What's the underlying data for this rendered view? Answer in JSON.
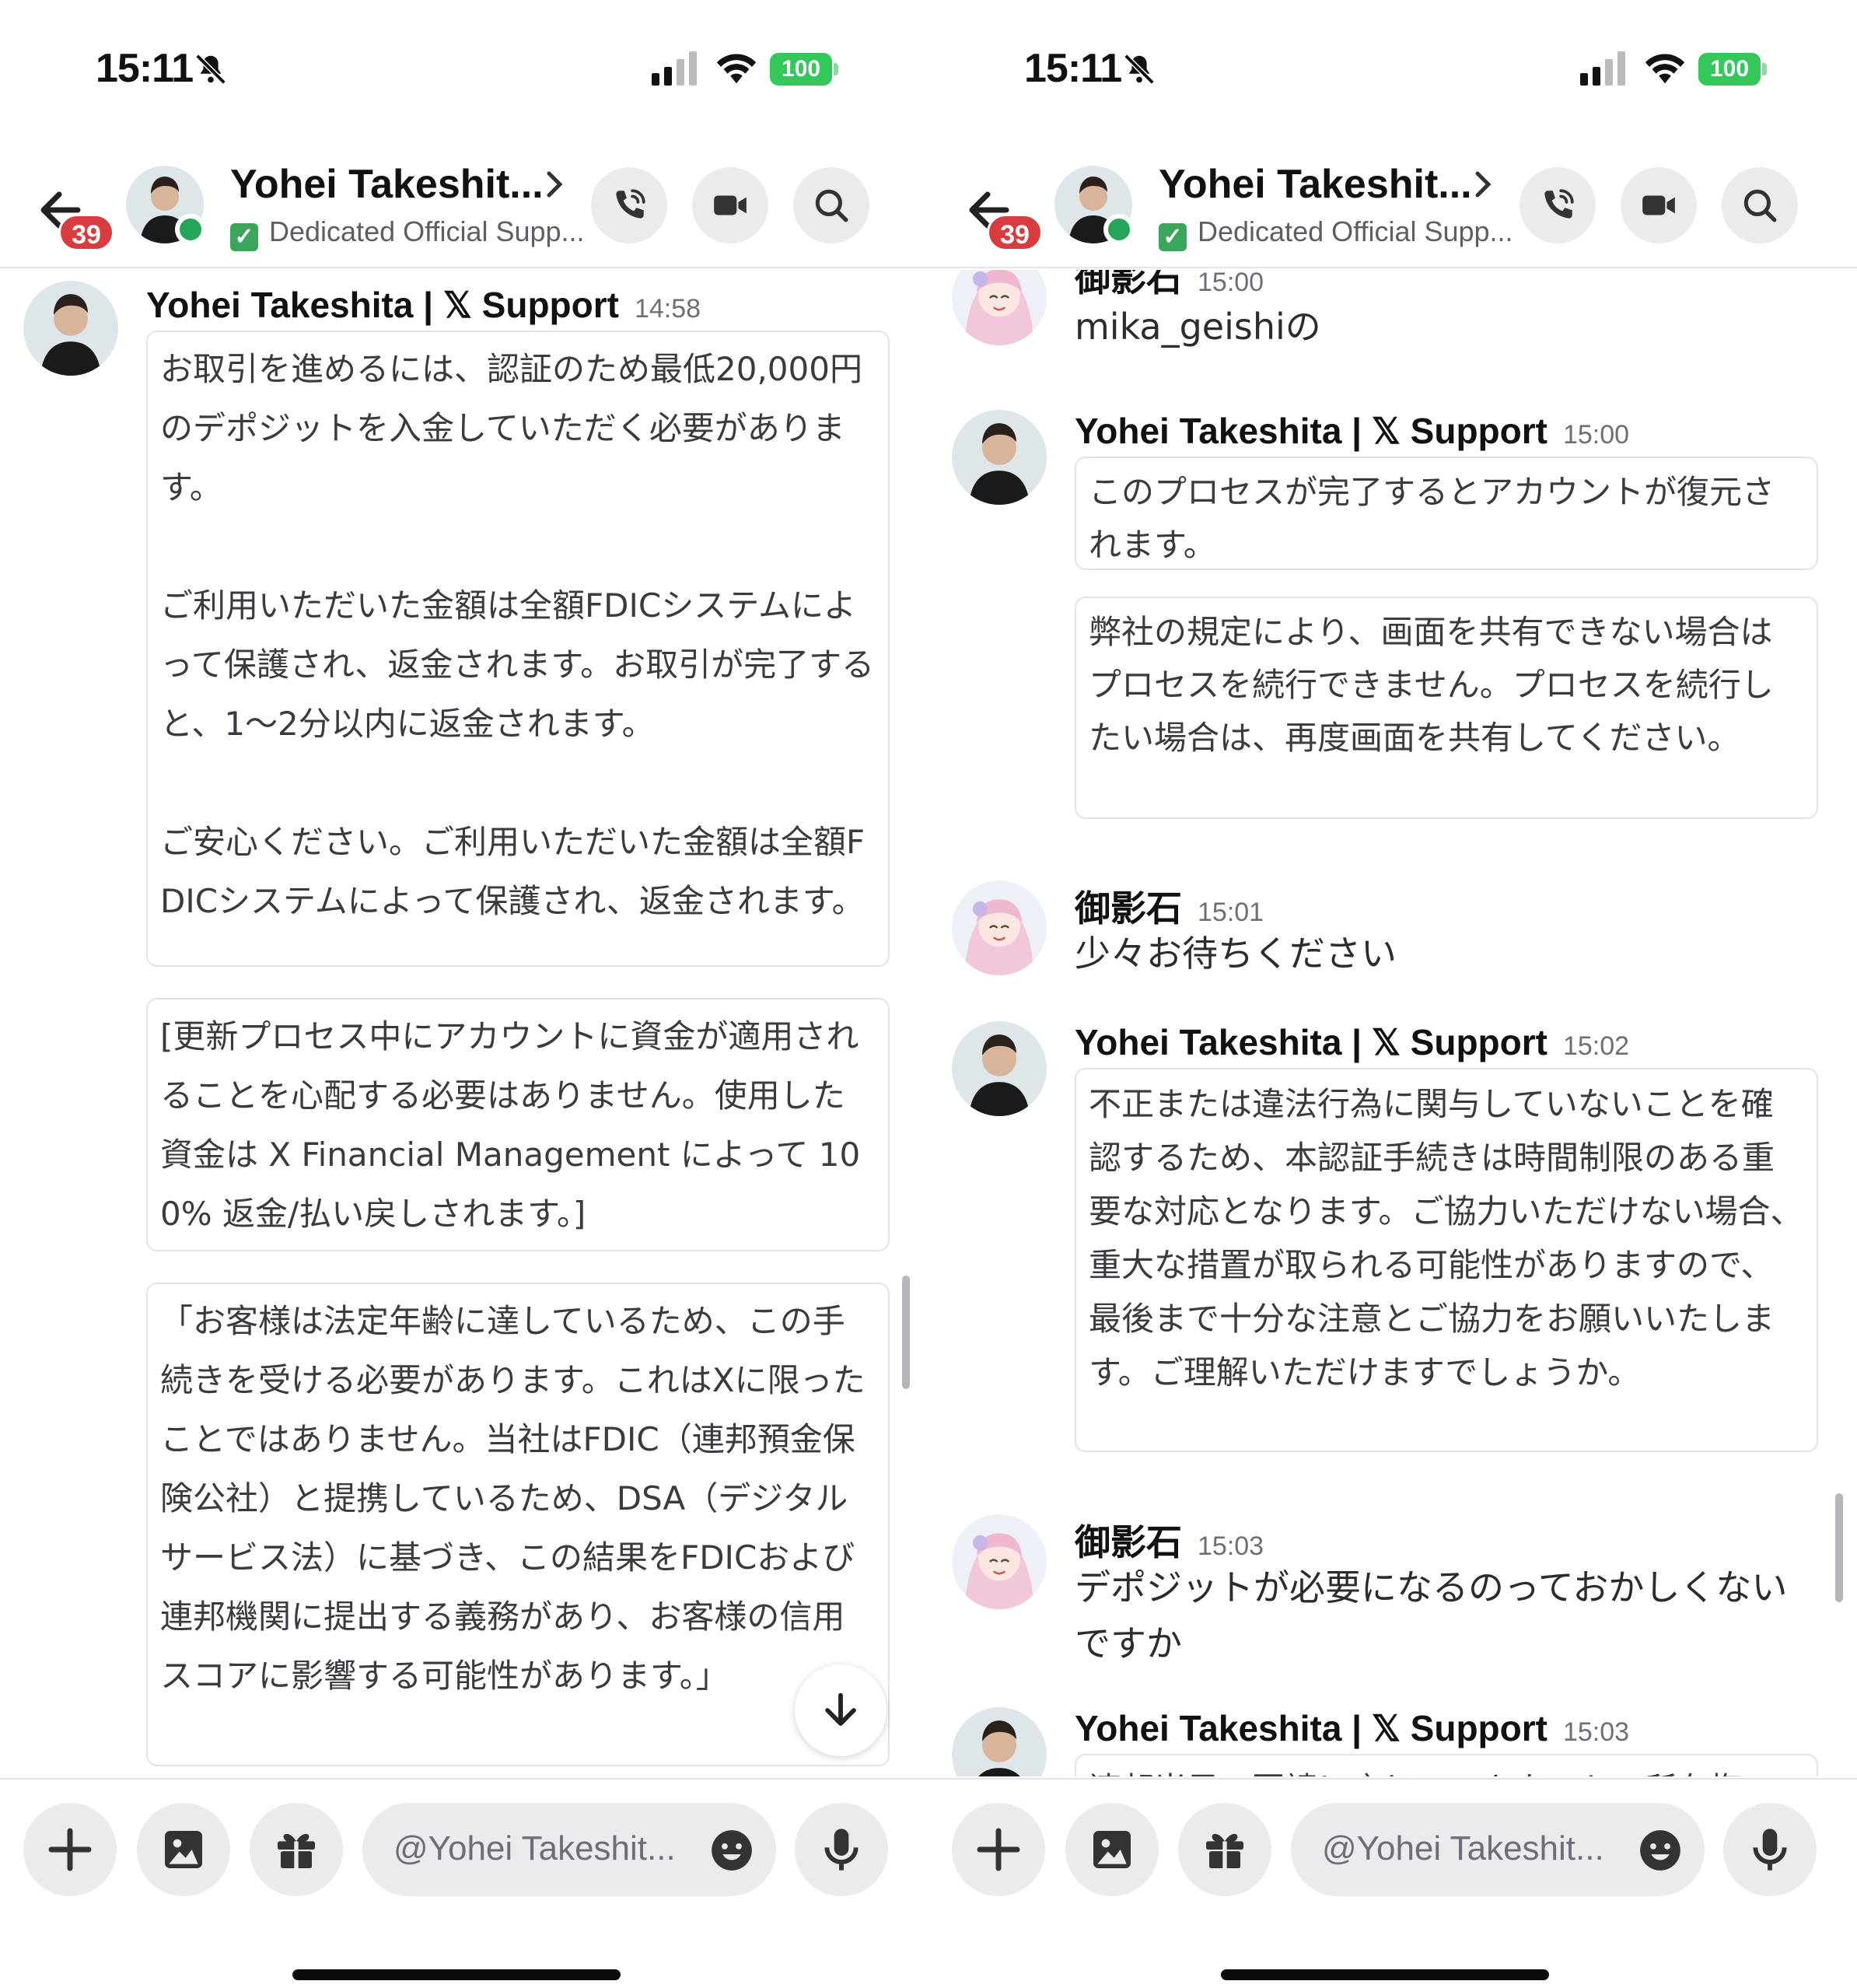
{
  "left": {
    "status": {
      "time": "15:11",
      "battery": "100"
    },
    "header": {
      "badge": "39",
      "name": "Yohei Takeshit...",
      "subtitle": "Dedicated Official Supp...",
      "check": "✓"
    },
    "messages": [
      {
        "author": "Yohei Takeshita | 𝕏 Support",
        "time": "14:58",
        "embeds": [
          "お取引を進めるには、認証のため最低20,000円のデポジットを入金していただく必要があります。\n\nご利用いただいた金額は全額FDICシステムによって保護され、返金されます。お取引が完了すると、1～2分以内に返金されます。\n\nご安心ください。ご利用いただいた金額は全額FDICシステムによって保護され、返金されます。",
          "[更新プロセス中にアカウントに資金が適用されることを心配する必要はありません。使用した資金は X Financial Management によって 100% 返金/払い戻しされます。]",
          "「お客様は法定年齢に達しているため、この手続きを受ける必要があります。これはXに限ったことではありません。当社はFDIC（連邦預金保険公社）と提携しているため、DSA（デジタルサービス法）に基づき、この結果をFDICおよび連邦機関に提出する義務があり、お客様の信用スコアに影響する可能性があります。」"
        ]
      }
    ],
    "composer": {
      "placeholder": "@Yohei Takeshit..."
    }
  },
  "right": {
    "status": {
      "time": "15:11",
      "battery": "100"
    },
    "header": {
      "badge": "39",
      "name": "Yohei Takeshit...",
      "subtitle": "Dedicated Official Supp...",
      "check": "✓"
    },
    "messages": [
      {
        "author": "御影石",
        "time": "15:00",
        "text": "mika_geishiの"
      },
      {
        "author": "Yohei Takeshita | 𝕏 Support",
        "time": "15:00",
        "embeds": [
          "このプロセスが完了するとアカウントが復元されます。",
          "弊社の規定により、画面を共有できない場合はプロセスを続行できません。プロセスを続行したい場合は、再度画面を共有してください。"
        ]
      },
      {
        "author": "御影石",
        "time": "15:01",
        "text": "少々お待ちください"
      },
      {
        "author": "Yohei Takeshita | 𝕏 Support",
        "time": "15:02",
        "embeds": [
          "不正または違法行為に関与していないことを確認するため、本認証手続きは時間制限のある重要な対応となります。ご協力いただけない場合、重大な措置が取られる可能性がありますので、最後まで十分な注意とご協力をお願いいたします。ご理解いただけますでしょうか。"
        ]
      },
      {
        "author": "御影石",
        "time": "15:03",
        "text": "デポジットが必要になるのっておかしくないですか"
      },
      {
        "author": "Yohei Takeshita | 𝕏 Support",
        "time": "15:03",
        "embeds": [
          "連邦当局の要請に応じてアカウントの所有権"
        ]
      }
    ],
    "composer": {
      "placeholder": "@Yohei Takeshit..."
    }
  },
  "icons": [
    "back-arrow-icon",
    "phone-icon",
    "video-camera-icon",
    "search-icon",
    "plus-icon",
    "image-icon",
    "gift-icon",
    "emoji-icon",
    "microphone-icon",
    "arrow-down-icon",
    "bell-slash-icon",
    "signal-icon",
    "wifi-icon",
    "chevron-right-icon"
  ],
  "colors": {
    "badge": "#d83c3e",
    "online": "#23a55a",
    "battery": "#34c759",
    "button_bg": "#eaebed"
  }
}
